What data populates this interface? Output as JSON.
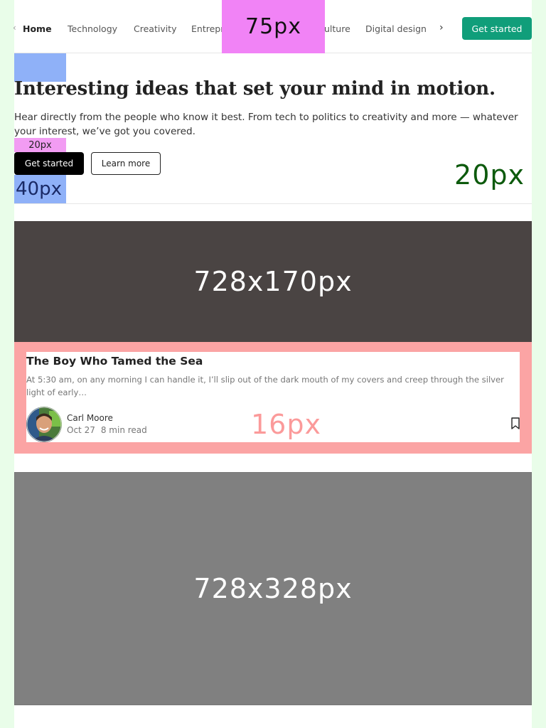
{
  "nav": {
    "items": [
      "Home",
      "Technology",
      "Creativity",
      "Entrepreneurship",
      "Culture",
      "Digital design"
    ],
    "item_positions_visible": [
      "Home",
      "Technology",
      "Creativity",
      "Entrepr",
      "ulture",
      "Digital design"
    ],
    "cta": "Get started",
    "overlay_label": "75px"
  },
  "hero": {
    "title": "Interesting ideas that set your mind in motion.",
    "subtitle": "Hear directly from the people who know it best. From tech to politics to creativity and more — whatever your interest, we’ve got you covered.",
    "spacer_label_small": "20px",
    "primary_button": "Get started",
    "secondary_button": "Learn more",
    "spacer_label_large": "40px",
    "gap_label": "20px"
  },
  "featured": {
    "top_image_label": "728x170px",
    "bottom_image_label": "728x328px"
  },
  "card": {
    "title": "The Boy Who Tamed the Sea",
    "excerpt": "At 5:30 am, on any morning I can handle it, I’ll slip out of the dark mouth of my covers and creep through the silver light of early…",
    "author": "Carl Moore",
    "date": "Oct 27",
    "read_time": "8 min read",
    "gap_label": "16px"
  },
  "colors": {
    "accent": "#109e7a",
    "spacer_blue": "#8fb1f8",
    "spacer_pink": "#f29cf3",
    "card_highlight": "#fba4a4",
    "page_bg": "#e9fde9"
  },
  "icons": {
    "nav_prev": "chevron-left-icon",
    "nav_next": "chevron-right-icon",
    "bookmark": "bookmark-icon"
  }
}
